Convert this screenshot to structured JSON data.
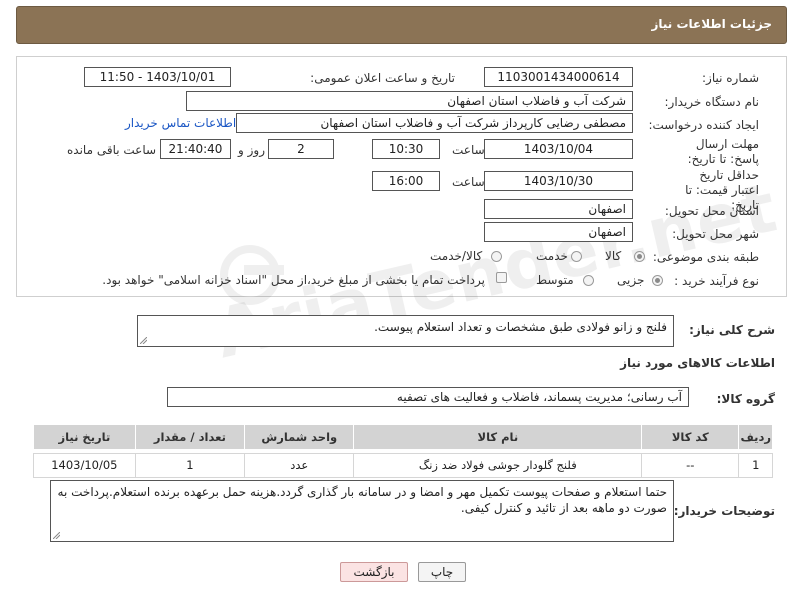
{
  "header": {
    "title": "جزئیات اطلاعات نیاز"
  },
  "form": {
    "need_number": {
      "label": "شماره نیاز:",
      "value": "1103001434000614"
    },
    "announce": {
      "label": "تاریخ و ساعت اعلان عمومی:",
      "value": "1403/10/01 - 11:50"
    },
    "buyer_org": {
      "label": "نام دستگاه خریدار:",
      "value": "شرکت آب و فاضلاب استان اصفهان"
    },
    "creator": {
      "label": "ایجاد کننده درخواست:",
      "value": "مصطفی رضایی کارپرداز شرکت آب و فاضلاب استان اصفهان",
      "contact_link": "اطلاعات تماس خریدار"
    },
    "reply_deadline": {
      "label": "مهلت ارسال پاسخ: تا تاریخ:",
      "date": "1403/10/04",
      "time_label": "ساعت",
      "time": "10:30",
      "days": "2",
      "days_label": "روز و",
      "remaining": "21:40:40",
      "remaining_label": "ساعت باقی مانده"
    },
    "price_validity": {
      "label": "حداقل تاریخ اعتبار قیمت: تا تاریخ:",
      "date": "1403/10/30",
      "time_label": "ساعت",
      "time": "16:00"
    },
    "province": {
      "label": "استان محل تحویل:",
      "value": "اصفهان"
    },
    "city": {
      "label": "شهر محل تحویل:",
      "value": "اصفهان"
    },
    "category": {
      "label": "طبقه بندی موضوعی:",
      "options": [
        "کالا",
        "خدمت",
        "کالا/خدمت"
      ],
      "selected": "کالا"
    },
    "purchase_type": {
      "label": "نوع فرآیند خرید :",
      "options": [
        "جزیی",
        "متوسط"
      ],
      "selected": "جزیی",
      "payment_note": "پرداخت تمام یا بخشی از مبلغ خرید،از محل \"اسناد خزانه اسلامی\" خواهد بود."
    }
  },
  "description": {
    "label": "شرح کلی نیاز:",
    "value": "فلنج و زانو فولادی طبق مشخصات و تعداد استعلام پیوست."
  },
  "goods_section_title": "اطلاعات کالاهای مورد نیاز",
  "goods_group": {
    "label": "گروه کالا:",
    "value": "آب رسانی؛ مدیریت پسماند، فاضلاب و فعالیت های تصفیه"
  },
  "table": {
    "headers": [
      "ردیف",
      "کد کالا",
      "نام کالا",
      "واحد شمارش",
      "تعداد / مقدار",
      "تاریخ نیاز"
    ],
    "rows": [
      [
        "1",
        "--",
        "فلنج گلودار جوشی فولاد ضد زنگ",
        "عدد",
        "1",
        "1403/10/05"
      ]
    ]
  },
  "buyer_notes": {
    "label": "توضیحات خریدار:",
    "value": "حتما استعلام و صفحات پیوست تکمیل مهر و امضا و در سامانه بار گذاری گردد.هزینه حمل برعهده برنده استعلام.پرداخت به صورت دو ماهه بعد از تائید و کنترل کیفی."
  },
  "buttons": {
    "print": "چاپ",
    "back": "بازگشت"
  },
  "colors": {
    "header_bg": "#8b7355",
    "link": "#1a56c4",
    "back_button_bg": "#fbe3e3"
  },
  "icons": [
    "radio-icon",
    "checkbox-icon",
    "resize-grip-icon"
  ]
}
